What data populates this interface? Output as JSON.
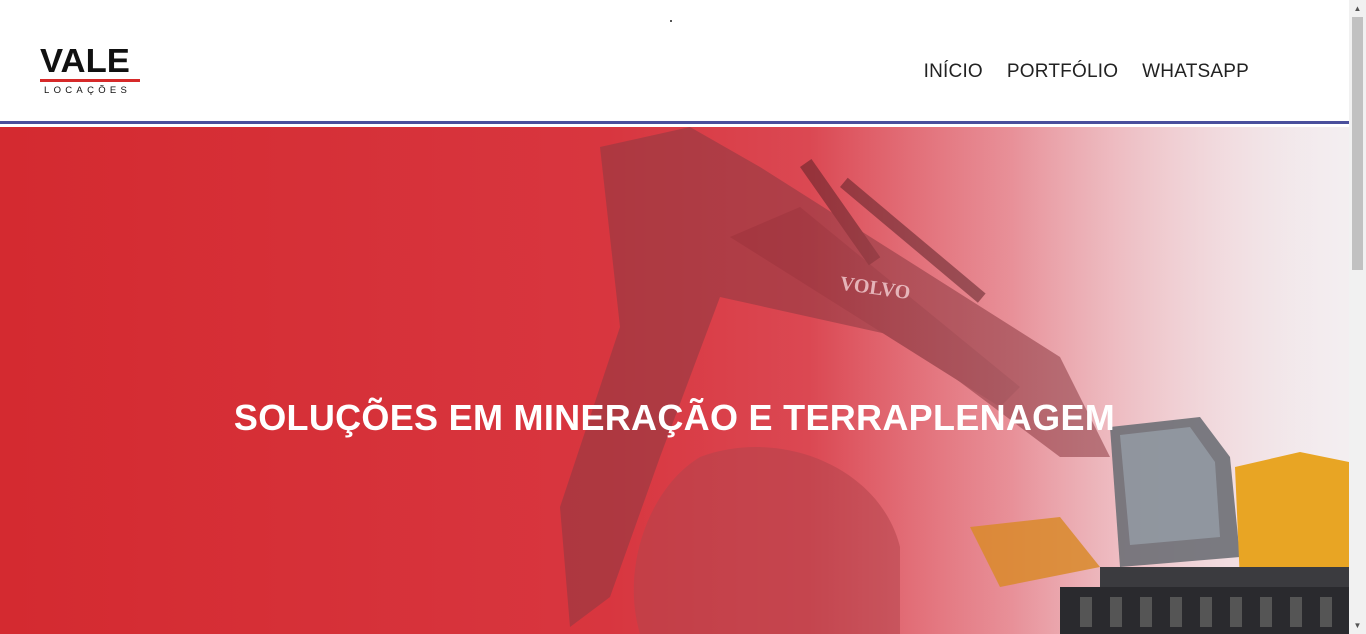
{
  "header": {
    "logo_word": "VALE",
    "logo_sub": "LOCAÇÕES",
    "nav": [
      {
        "label": "INÍCIO"
      },
      {
        "label": "PORTFÓLIO"
      },
      {
        "label": "WHATSAPP"
      }
    ]
  },
  "hero": {
    "title": "SOLUÇÕES EM MINERAÇÃO E TERRAPLENAGEM",
    "brand_on_machine": "VOLVO"
  },
  "colors": {
    "accent_red": "#d62a2a",
    "header_border": "#4a4f9c",
    "machine_yellow": "#e8a524"
  }
}
